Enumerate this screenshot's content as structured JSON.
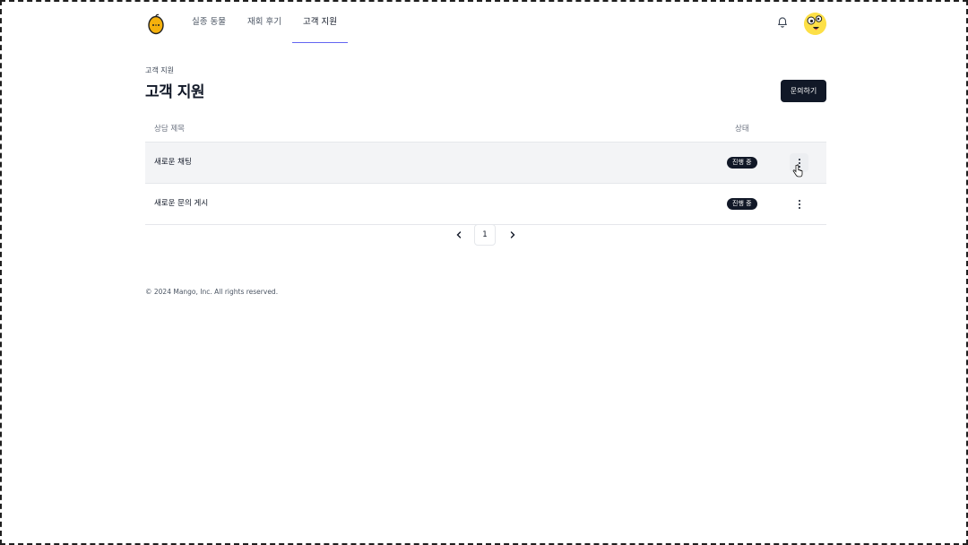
{
  "header": {
    "nav": [
      {
        "label": "실종 동물"
      },
      {
        "label": "재회 후기"
      },
      {
        "label": "고객 지원",
        "active": true
      }
    ],
    "logo_icon": "mango-logo",
    "bell_icon": "bell-icon",
    "avatar_icon": "avatar"
  },
  "page": {
    "breadcrumb": "고객 지원",
    "title": "고객 지원",
    "ask_button": "문의하기"
  },
  "table": {
    "headers": {
      "title": "상담 제목",
      "status": "상태"
    },
    "rows": [
      {
        "title": "새로운 채팅",
        "status": "진행 중"
      },
      {
        "title": "새로운 문의 게시",
        "status": "진행 중"
      }
    ]
  },
  "pagination": {
    "current": "1"
  },
  "footer": {
    "copyright": "© 2024 Mango, Inc. All rights reserved."
  },
  "colors": {
    "primary": "#111827",
    "accent": "#6366f1",
    "avatar_bg": "#fde047",
    "logo": "#f59e0b"
  }
}
